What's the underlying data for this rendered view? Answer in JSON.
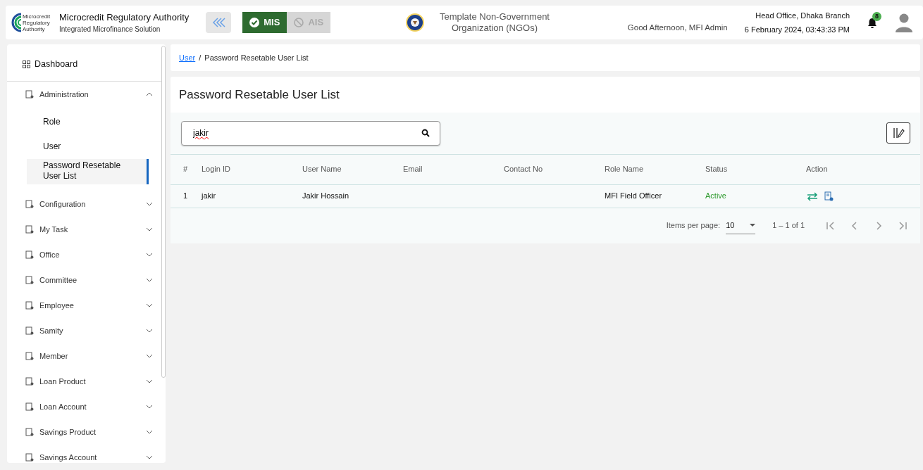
{
  "header": {
    "logo_text": "Microcredit Regulatory Authority",
    "title": "Microcredit Regulatory Authority",
    "subtitle": "Integrated Microfinance Solution",
    "modules": [
      {
        "label": "MIS",
        "selected": true
      },
      {
        "label": "AIS",
        "selected": false
      }
    ],
    "organization": "Template Non-Government Organization (NGOs)",
    "greeting": "Good Afternoon, MFI Admin",
    "branch": "Head Office, Dhaka Branch",
    "datetime": "6 February 2024, 03:43:33 PM",
    "notification_count": "8"
  },
  "sidebar": {
    "items": [
      {
        "label": "Dashboard",
        "kind": "top"
      },
      {
        "label": "Administration",
        "kind": "group",
        "expanded": true,
        "children": [
          {
            "label": "Role",
            "selected": false
          },
          {
            "label": "User",
            "selected": false
          },
          {
            "label": "Password Resetable User List",
            "selected": true
          }
        ]
      },
      {
        "label": "Configuration",
        "kind": "group",
        "expanded": false
      },
      {
        "label": "My Task",
        "kind": "group",
        "expanded": false
      },
      {
        "label": "Office",
        "kind": "group",
        "expanded": false
      },
      {
        "label": "Committee",
        "kind": "group",
        "expanded": false
      },
      {
        "label": "Employee",
        "kind": "group",
        "expanded": false
      },
      {
        "label": "Samity",
        "kind": "group",
        "expanded": false
      },
      {
        "label": "Member",
        "kind": "group",
        "expanded": false
      },
      {
        "label": "Loan Product",
        "kind": "group",
        "expanded": false
      },
      {
        "label": "Loan Account",
        "kind": "group",
        "expanded": false
      },
      {
        "label": "Savings Product",
        "kind": "group",
        "expanded": false
      },
      {
        "label": "Savings Account",
        "kind": "group",
        "expanded": false
      }
    ]
  },
  "breadcrumb": [
    {
      "label": "User",
      "link": true
    },
    {
      "label": "/",
      "link": false
    },
    {
      "label": "Password Resetable User List",
      "link": false
    }
  ],
  "page_title": "Password Resetable User List",
  "search": {
    "value": "jakir"
  },
  "table": {
    "columns": [
      "#",
      "Login ID",
      "User Name",
      "Email",
      "Contact No",
      "Role Name",
      "Status",
      "Action"
    ],
    "rows": [
      {
        "cells": [
          "1",
          "jakir",
          "Jakir Hossain",
          "",
          "",
          "MFI Field Officer",
          "Active"
        ]
      }
    ]
  },
  "paginator": {
    "label": "Items per page:",
    "page_size": "10",
    "range": "1 – 1 of 1"
  }
}
